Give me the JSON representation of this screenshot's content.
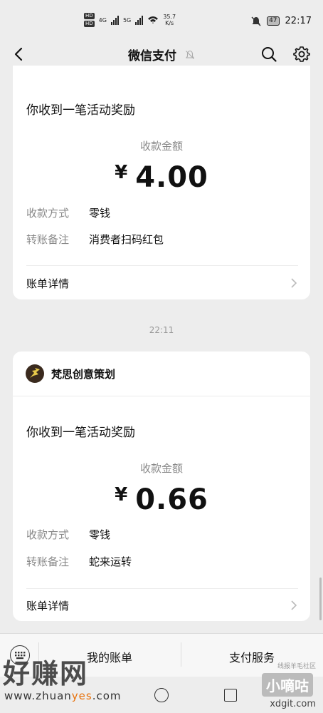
{
  "status_bar": {
    "hd1": "HD",
    "hd2": "HD",
    "net1": "4G",
    "net2": "5G",
    "speed_value": "35.7",
    "speed_unit": "K/s",
    "battery": "47",
    "time": "22:17"
  },
  "nav": {
    "title": "微信支付"
  },
  "card1": {
    "title": "你收到一笔活动奖励",
    "amount_label": "收款金额",
    "currency": "¥",
    "amount": "4.00",
    "method_label": "收款方式",
    "method_value": "零钱",
    "note_label": "转账备注",
    "note_value": "消费者扫码红包",
    "detail_label": "账单详情"
  },
  "separator_time": "22:11",
  "card2": {
    "merchant": "梵思创意策划",
    "title": "你收到一笔活动奖励",
    "amount_label": "收款金额",
    "currency": "¥",
    "amount": "0.66",
    "method_label": "收款方式",
    "method_value": "零钱",
    "note_label": "转账备注",
    "note_value": "蛇来运转",
    "detail_label": "账单详情"
  },
  "bottom_menu": {
    "bills": "我的账单",
    "services": "支付服务"
  },
  "watermark": {
    "brand": "好赚网",
    "url_a": "www.zhuan",
    "url_b": "yes",
    "url_c": ".com",
    "brand2_top": "线报羊毛社区",
    "brand2": "小嘀咕",
    "brand2_url": "xdgit.com"
  },
  "colors": {
    "background": "#ededed",
    "card": "#ffffff",
    "accent_orange": "#e8720c"
  }
}
